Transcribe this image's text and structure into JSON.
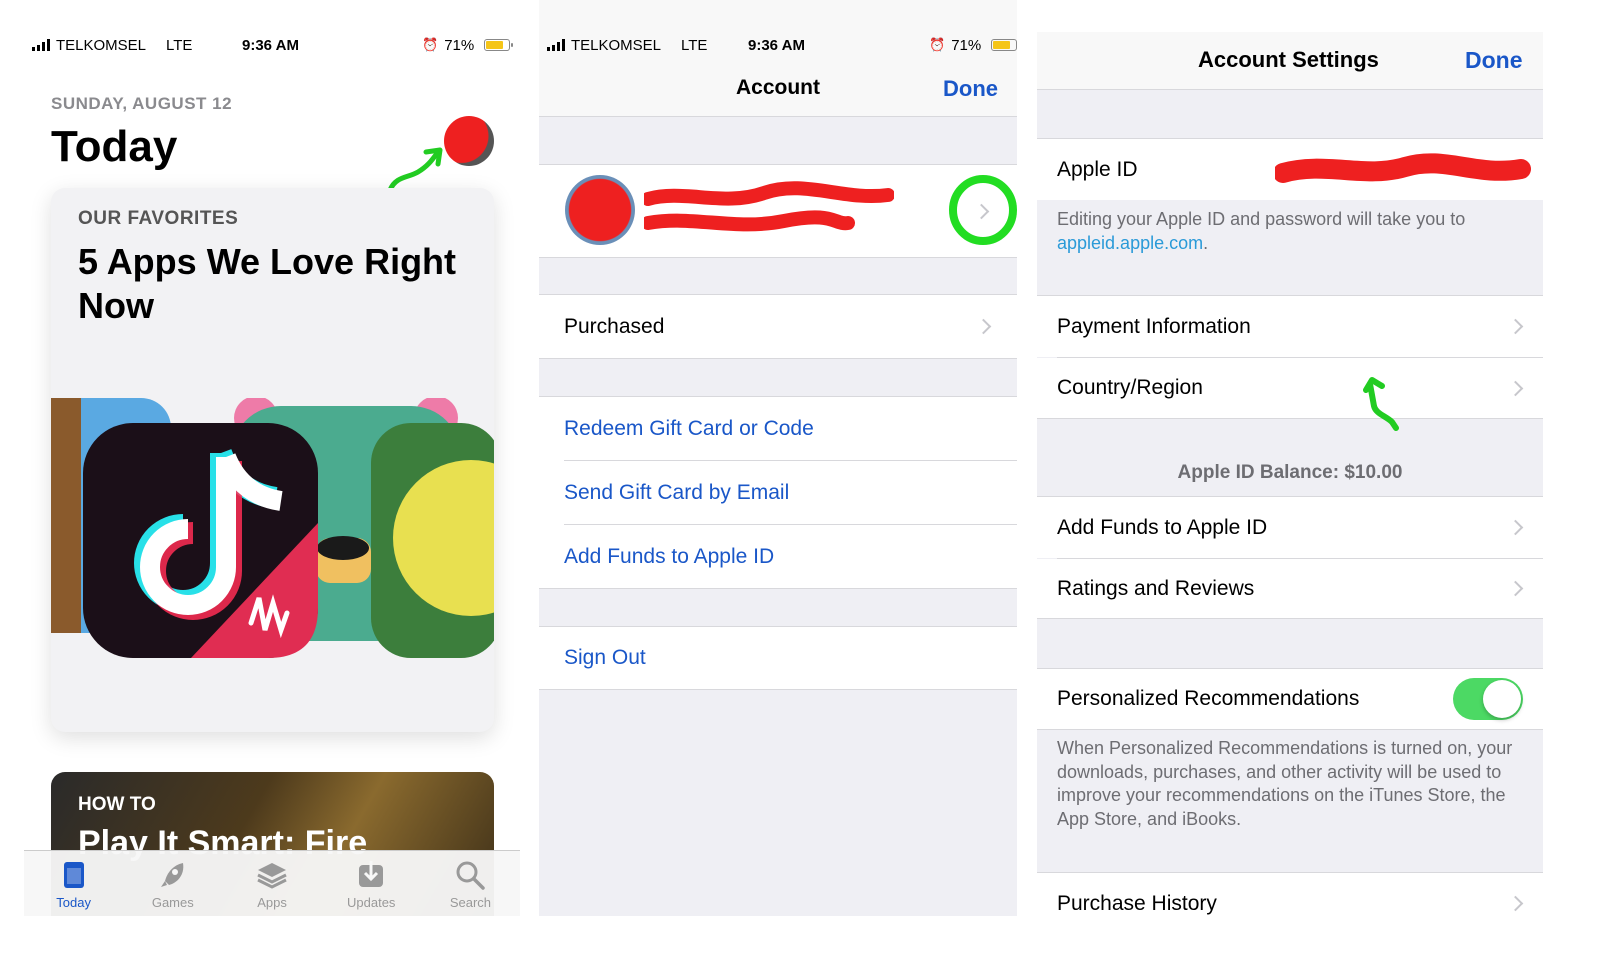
{
  "colors": {
    "accent": "#1a57c8",
    "link": "#2a9ad8",
    "toggle_on": "#4cd964",
    "redaction": "#ee2020",
    "annotation": "#22cc22"
  },
  "status_bars": [
    {
      "carrier": "TELKOMSEL",
      "network": "LTE",
      "time": "9:36 AM",
      "battery": "71%"
    },
    {
      "carrier": "TELKOMSEL",
      "network": "LTE",
      "time": "9:36 AM",
      "battery": "71%"
    }
  ],
  "today_screen": {
    "date": "SUNDAY, AUGUST 12",
    "title": "Today",
    "card1": {
      "tag": "OUR FAVORITES",
      "title": "5 Apps We Love Right Now"
    },
    "card2": {
      "tag": "HOW TO",
      "title": "Play It Smart: Fire"
    },
    "tabbar": [
      {
        "label": "Today",
        "icon": "today-icon",
        "active": true
      },
      {
        "label": "Games",
        "icon": "rocket-icon",
        "active": false
      },
      {
        "label": "Apps",
        "icon": "layers-icon",
        "active": false
      },
      {
        "label": "Updates",
        "icon": "download-icon",
        "active": false
      },
      {
        "label": "Search",
        "icon": "search-icon",
        "active": false
      }
    ]
  },
  "account_screen": {
    "title": "Account",
    "done": "Done",
    "purchased": "Purchased",
    "redeem": "Redeem Gift Card or Code",
    "send_gift": "Send Gift Card by Email",
    "add_funds": "Add Funds to Apple ID",
    "sign_out": "Sign Out"
  },
  "account_settings": {
    "title": "Account Settings",
    "done": "Done",
    "apple_id_label": "Apple ID",
    "apple_id_note_prefix": "Editing your Apple ID and password will take you to ",
    "apple_id_note_link": "appleid.apple.com",
    "apple_id_note_suffix": ".",
    "payment_info": "Payment Information",
    "country_region": "Country/Region",
    "balance": "Apple ID Balance: $10.00",
    "add_funds": "Add Funds to Apple ID",
    "ratings": "Ratings and Reviews",
    "personalized": "Personalized Recommendations",
    "personalized_on": true,
    "personalized_note": "When Personalized Recommendations is turned on, your downloads, purchases, and other activity will be used to improve your recommendations on the iTunes Store, the App Store, and iBooks.",
    "purchase_history": "Purchase History"
  }
}
